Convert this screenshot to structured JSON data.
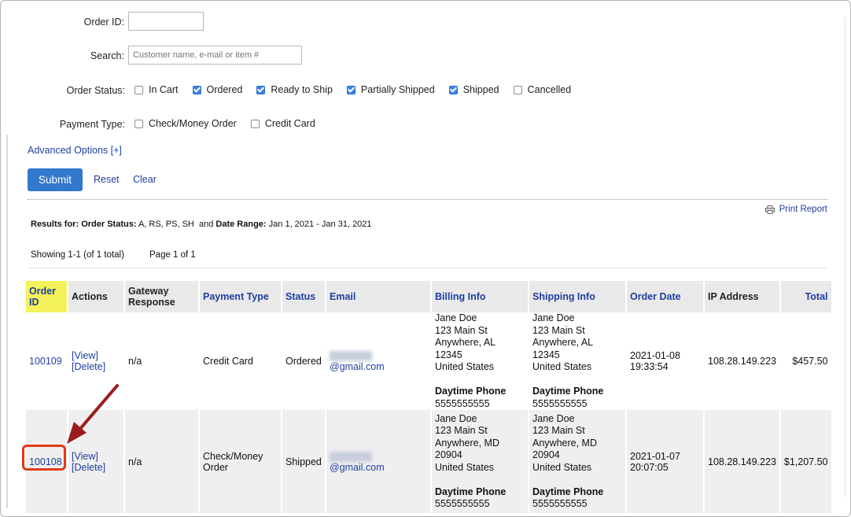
{
  "form": {
    "order_id_label": "Order ID:",
    "order_id_value": "",
    "search_label": "Search:",
    "search_placeholder": "Customer name, e-mail or item #",
    "status_label": "Order Status:",
    "status_options": [
      {
        "label": "In Cart",
        "checked": false
      },
      {
        "label": "Ordered",
        "checked": true
      },
      {
        "label": "Ready to Ship",
        "checked": true
      },
      {
        "label": "Partially Shipped",
        "checked": true
      },
      {
        "label": "Shipped",
        "checked": true
      },
      {
        "label": "Cancelled",
        "checked": false
      }
    ],
    "payment_label": "Payment Type:",
    "payment_options": [
      {
        "label": "Check/Money Order",
        "checked": false
      },
      {
        "label": "Credit Card",
        "checked": false
      }
    ],
    "advanced_label": "Advanced Options [+]",
    "submit_label": "Submit",
    "reset_label": "Reset",
    "clear_label": "Clear"
  },
  "report": {
    "print_label": "Print Report",
    "results_prefix": "Results for:",
    "status_key": "Order Status:",
    "status_value": "A, RS, PS, SH",
    "and_text": "and",
    "date_key": "Date Range:",
    "date_value": "Jan 1, 2021 - Jan 31, 2021",
    "showing": "Showing 1-1 (of 1 total)",
    "page": "Page 1 of 1"
  },
  "table": {
    "headers": {
      "order_id_1": "Order",
      "order_id_2": "ID",
      "actions": "Actions",
      "gateway_1": "Gateway",
      "gateway_2": "Response",
      "payment_type": "Payment Type",
      "status": "Status",
      "email": "Email",
      "billing": "Billing Info",
      "shipping": "Shipping Info",
      "order_date": "Order Date",
      "ip": "IP Address",
      "total": "Total"
    },
    "rows": [
      {
        "id": "100109",
        "view": "[View]",
        "delete": "[Delete]",
        "gateway": "n/a",
        "payment_type": "Credit Card",
        "status": "Ordered",
        "email_domain": "@gmail.com",
        "billing": {
          "name": "Jane Doe",
          "street": "123 Main St",
          "city": "Anywhere, AL 12345",
          "country": "United States",
          "phone_label": "Daytime Phone",
          "phone": "5555555555"
        },
        "shipping": {
          "name": "Jane Doe",
          "street": "123 Main St",
          "city": "Anywhere, AL 12345",
          "country": "United States",
          "phone_label": "Daytime Phone",
          "phone": "5555555555"
        },
        "date": "2021-01-08",
        "time": "19:33:54",
        "ip": "108.28.149.223",
        "total": "$457.50"
      },
      {
        "id": "100108",
        "view": "[View]",
        "delete": "[Delete]",
        "gateway": "n/a",
        "payment_type_1": "Check/Money",
        "payment_type_2": "Order",
        "status": "Shipped",
        "email_domain": "@gmail.com",
        "billing": {
          "name": "Jane Doe",
          "street": "123 Main St",
          "city": "Anywhere, MD",
          "zip": "20904",
          "country": "United States",
          "phone_label": "Daytime Phone",
          "phone": "5555555555"
        },
        "shipping": {
          "name": "Jane Doe",
          "street": "123 Main St",
          "city": "Anywhere, MD",
          "zip": "20904",
          "country": "United States",
          "phone_label": "Daytime Phone",
          "phone": "5555555555"
        },
        "date": "2021-01-07",
        "time": "20:07:05",
        "ip": "108.28.149.223",
        "total": "$1,207.50"
      }
    ]
  },
  "colors": {
    "link": "#1f3f9f",
    "submit": "#3278cc",
    "checkbox_on": "#3b84e5",
    "header_highlight": "#f4f25a",
    "annotation": "#e0391a",
    "arrow": "#9b1c1c"
  },
  "icons": {
    "print": "printer-icon"
  }
}
